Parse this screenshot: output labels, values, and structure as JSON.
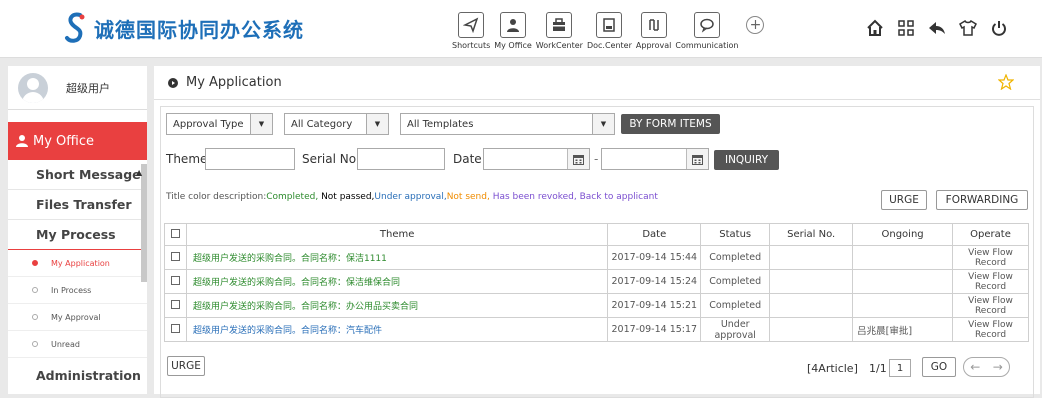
{
  "header": {
    "brand": "诚德国际协同办公系统",
    "modules": [
      {
        "label": "Shortcuts",
        "icon": "send-icon"
      },
      {
        "label": "My Office",
        "icon": "user-icon"
      },
      {
        "label": "WorkCenter",
        "icon": "briefcase-icon"
      },
      {
        "label": "Doc.Center",
        "icon": "document-icon"
      },
      {
        "label": "Approval",
        "icon": "approval-icon"
      },
      {
        "label": "Communication",
        "icon": "chat-icon"
      }
    ],
    "right_icons": [
      "home-icon",
      "grid-icon",
      "back-icon",
      "shirt-icon",
      "power-icon"
    ]
  },
  "sidebar": {
    "user_name": "超级用户",
    "section": "My Office",
    "items": [
      {
        "label": "Short Message"
      },
      {
        "label": "Files Transfer"
      },
      {
        "label": "My Process",
        "active": true
      }
    ],
    "sub_items": [
      {
        "label": "My Application",
        "active": true
      },
      {
        "label": "In Process"
      },
      {
        "label": "My Approval"
      },
      {
        "label": "Unread"
      }
    ],
    "bottom_item": "Administration"
  },
  "main": {
    "title": "My Application",
    "filters": {
      "approval_type": "Approval Type",
      "category": "All Category",
      "templates": "All Templates",
      "by_form_items": "BY FORM ITEMS",
      "theme_label": "Theme",
      "serial_label": "Serial No.",
      "date_label": "Date",
      "date_sep": "-",
      "inquiry": "INQUIRY"
    },
    "legend": {
      "prefix": "Title color description:",
      "completed": "Completed,",
      "not_passed": " Not passed,",
      "under_approval": "Under approval,",
      "not_send": "Not send,",
      "revoked": " Has been revoked,",
      "back": " Back to applicant"
    },
    "urge": "URGE",
    "forwarding": "FORWARDING",
    "columns": [
      "Theme",
      "Date",
      "Status",
      "Serial No.",
      "Ongoing",
      "Operate"
    ],
    "rows": [
      {
        "theme": "超级用户发送的采购合同。合同名称：保洁1111",
        "date": "2017-09-14 15:44",
        "status": "Completed",
        "serial": "",
        "ongoing": "",
        "op1": "View Flow",
        "op2": "Record",
        "color": "#2e8b2e"
      },
      {
        "theme": "超级用户发送的采购合同。合同名称：保洁维保合同",
        "date": "2017-09-14 15:24",
        "status": "Completed",
        "serial": "",
        "ongoing": "",
        "op1": "View Flow",
        "op2": "Record",
        "color": "#2e8b2e"
      },
      {
        "theme": "超级用户发送的采购合同。合同名称：办公用品买卖合同",
        "date": "2017-09-14 15:21",
        "status": "Completed",
        "serial": "",
        "ongoing": "",
        "op1": "View Flow",
        "op2": "Record",
        "color": "#2e8b2e"
      },
      {
        "theme": "超级用户发送的采购合同。合同名称：汽车配件",
        "date": "2017-09-14 15:17",
        "status": "Under approval",
        "serial": "",
        "ongoing": "吕兆晨[审批]",
        "op1": "View Flow",
        "op2": "Record",
        "color": "#2a6fb8"
      }
    ],
    "pager": {
      "urge": "URGE",
      "count": "[4Article]",
      "page": "1/1",
      "page_input": "1",
      "go": "GO"
    }
  },
  "colors": {
    "accent": "#e94040",
    "brand": "#1e6fb8",
    "completed": "#2e8b2e",
    "under_approval": "#2a6fb8",
    "not_send": "#f08c00",
    "revoked": "#7b4fd0"
  }
}
